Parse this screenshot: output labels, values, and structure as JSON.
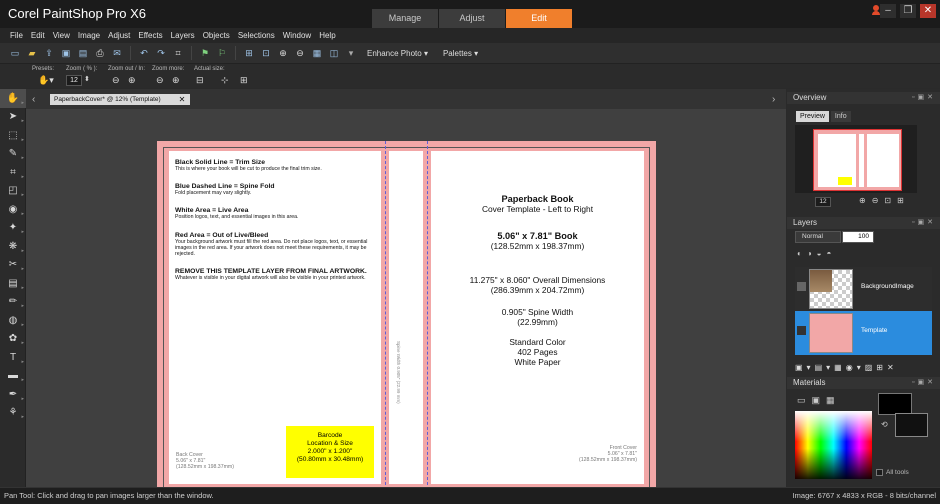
{
  "app": {
    "title": "Corel PaintShop Pro X6",
    "workspace_tabs": [
      {
        "label": "Manage",
        "active": false
      },
      {
        "label": "Adjust",
        "active": false
      },
      {
        "label": "Edit",
        "active": true
      }
    ],
    "accent_color": "#f07f2c"
  },
  "menu": [
    "File",
    "Edit",
    "View",
    "Image",
    "Adjust",
    "Effects",
    "Layers",
    "Objects",
    "Selections",
    "Window",
    "Help"
  ],
  "toolbar": {
    "enhance_photo": "Enhance Photo",
    "palettes": "Palettes"
  },
  "tool_options": {
    "presets_label": "Presets:",
    "zoom_label": "Zoom ( % ):",
    "zoom_value": "12",
    "zoom_out_in_label": "Zoom out / In:",
    "zoom_more_label": "Zoom more:",
    "actual_size_label": "Actual size:"
  },
  "document": {
    "tab_label": "PaperbackCover* @  12% (Template)",
    "back": {
      "sections": [
        {
          "heading": "Black Solid Line = Trim Size",
          "body": "This is where your book will be cut to produce the final trim size."
        },
        {
          "heading": "Blue Dashed Line = Spine Fold",
          "body": "Fold placement may vary slightly."
        },
        {
          "heading": "White Area = Live Area",
          "body": "Position logos, text, and essential images in this area."
        },
        {
          "heading": "Red Area = Out of Live/Bleed",
          "body": "Your background artwork must fill the red area. Do not place logos, text, or essential images in the red area. If your artwork does not meet these requirements, it may be rejected."
        },
        {
          "heading": "REMOVE THIS TEMPLATE LAYER FROM FINAL ARTWORK.",
          "body": "Whatever is visible in your digital artwork will also be visible in your printed artwork."
        }
      ],
      "cover_label": "Back Cover",
      "cover_size": "5.06\" x 7.81\"",
      "cover_mm": "(128.52mm x 198.37mm)"
    },
    "barcode": {
      "line1": "Barcode",
      "line2": "Location & Size",
      "line3": "2.000\" x 1.200\"",
      "line4": "(50.80mm x 30.48mm)"
    },
    "spine_text": "Spine Width 0.905\" (22.99 mm)",
    "front": {
      "title": "Paperback Book",
      "subtitle": "Cover Template - Left to Right",
      "book_size": "5.06\" x 7.81\" Book",
      "book_mm": "(128.52mm x 198.37mm)",
      "overall": "11.275\" x 8.060\" Overall Dimensions",
      "overall_mm": "(286.39mm x 204.72mm)",
      "spine": "0.905\" Spine Width",
      "spine_mm": "(22.99mm)",
      "color": "Standard Color",
      "pages": "402 Pages",
      "paper": "White Paper",
      "cover_label": "Front Cover",
      "cover_size": "5.06\" x 7.81\"",
      "cover_mm": "(128.52mm x 198.37mm)"
    },
    "bleed_color": "#f2a7a7",
    "fold_color": "#6060d8"
  },
  "panels": {
    "overview": {
      "title": "Overview",
      "tabs": [
        {
          "label": "Preview",
          "active": true
        },
        {
          "label": "Info",
          "active": false
        }
      ],
      "zoom_value": "12"
    },
    "layers": {
      "title": "Layers",
      "blend_mode": "Normal",
      "opacity": "100",
      "items": [
        {
          "name": "BackgroundImage",
          "selected": false
        },
        {
          "name": "Template",
          "selected": true
        }
      ],
      "selection_color": "#2b8cde"
    },
    "materials": {
      "title": "Materials",
      "all_tools": "All tools"
    }
  },
  "status": {
    "left": "Pan Tool: Click and drag to pan images larger than the window.",
    "right": "Image: 6767 x 4833 x RGB - 8 bits/channel"
  }
}
